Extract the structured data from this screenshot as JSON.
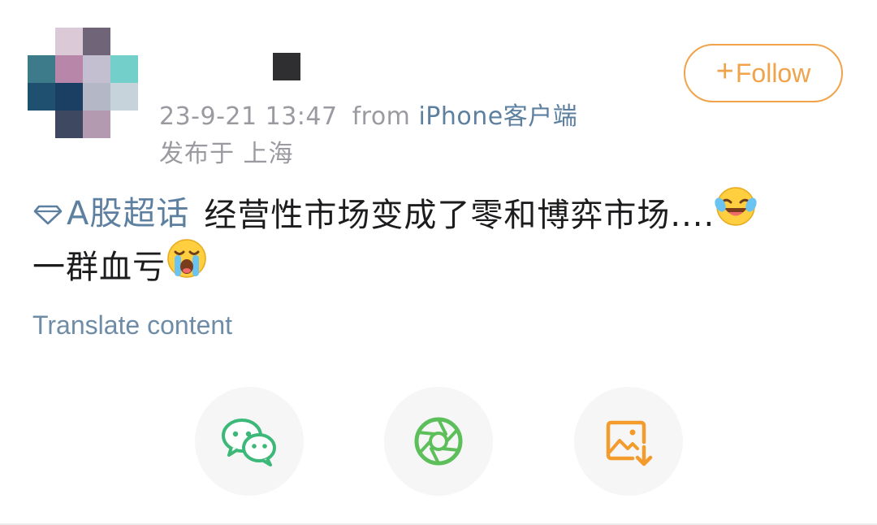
{
  "post": {
    "timestamp": "23-9-21 13:47",
    "source_prefix": "from",
    "source_device": "iPhone",
    "source_client": "客户端",
    "location": "发布于 上海",
    "topic": "A股超话",
    "text_line1": "经营性市场变成了零和博弈市场....",
    "text_line2": "一群血亏",
    "translate_label": "Translate content"
  },
  "follow": {
    "plus": "+",
    "label": "Follow"
  },
  "colors": {
    "accent_orange": "#f0a34a",
    "link_blue": "#5d7fa0",
    "meta_gray": "#9a9aa0",
    "wechat_green": "#3cb878",
    "moments_green": "#5cbf5a",
    "save_orange": "#f39b2c"
  },
  "icons": {
    "topic": "diamond-icon",
    "emoji_1": "laughing-crying-emoji",
    "emoji_2": "loudly-crying-emoji",
    "share_1": "wechat-icon",
    "share_2": "moments-icon",
    "share_3": "save-image-icon"
  }
}
